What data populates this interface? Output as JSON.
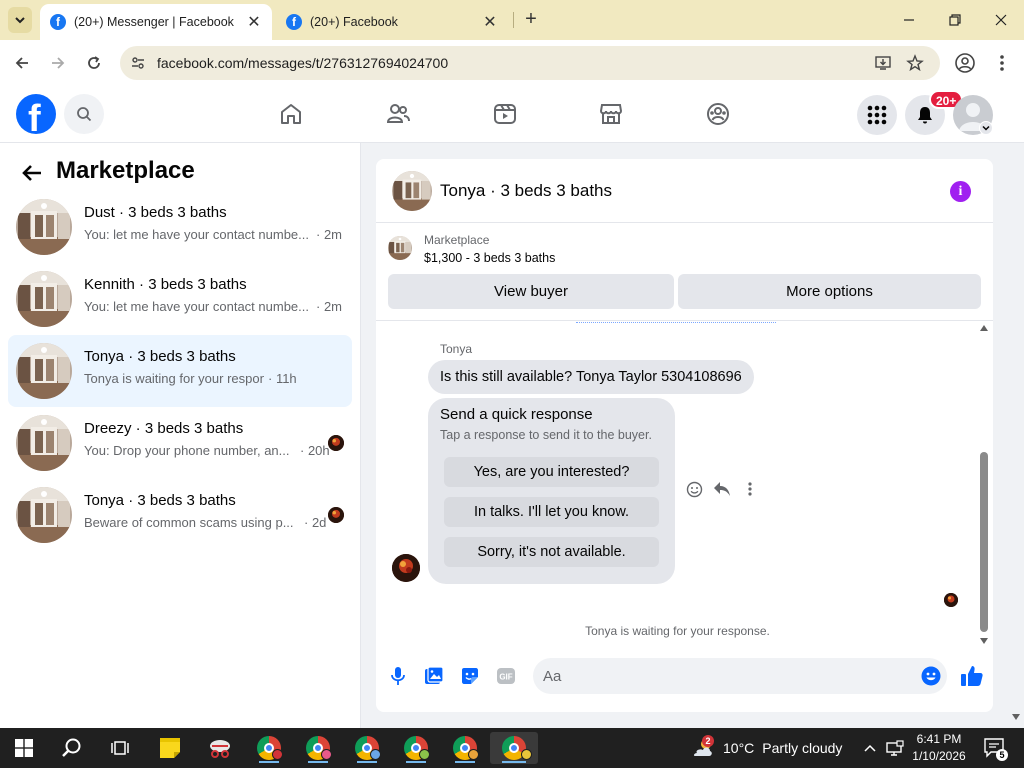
{
  "browser": {
    "tabs": [
      {
        "title": "(20+) Messenger | Facebook",
        "active": true
      },
      {
        "title": "(20+) Facebook",
        "active": false
      }
    ],
    "url": "facebook.com/messages/t/2763127694024700"
  },
  "fb": {
    "logo_letter": "f",
    "notifications_badge": "20+"
  },
  "sidebar": {
    "title": "Marketplace",
    "conversations": [
      {
        "name": "Dust · 3 beds 3 baths",
        "preview": "You: let me have your contact numbe...",
        "time": "· 2m",
        "selected": false,
        "seen": false
      },
      {
        "name": "Kennith · 3 beds 3 baths",
        "preview": "You: let me have your contact numbe...",
        "time": "· 2m",
        "selected": false,
        "seen": false
      },
      {
        "name": "Tonya · 3 beds 3 baths",
        "preview": "Tonya is waiting for your response.",
        "time": "· 11h",
        "selected": true,
        "seen": false
      },
      {
        "name": "Dreezy · 3 beds 3 baths",
        "preview": "You: Drop your phone number, an...",
        "time": "· 20h",
        "selected": false,
        "seen": true
      },
      {
        "name": "Tonya · 3 beds 3 baths",
        "preview": "Beware of common scams using p...",
        "time": "· 2d",
        "selected": false,
        "seen": true
      }
    ]
  },
  "chat": {
    "title": "Tonya · 3 beds 3 baths",
    "info_letter": "i",
    "listing": {
      "label": "Marketplace",
      "price_title": "$1,300 - 3 beds 3 baths",
      "view_buyer": "View buyer",
      "more_options": "More options"
    },
    "messages": {
      "sender": "Tonya",
      "text": "Is this still available? Tonya Taylor 5304108696"
    },
    "quick_response": {
      "title": "Send a quick response",
      "subtitle": "Tap a response to send it to the buyer.",
      "options": [
        "Yes, are you interested?",
        "In talks. I'll let you know.",
        "Sorry, it's not available."
      ]
    },
    "status": "Tonya is waiting for your response.",
    "composer": {
      "placeholder": "Aa",
      "gif_label": "GIF"
    }
  },
  "taskbar": {
    "weather": {
      "temp": "10°C",
      "condition": "Partly cloudy",
      "badge": "2"
    },
    "clock": {
      "time": "6:41 PM",
      "date": "1/10/2026"
    },
    "notification_count": "5"
  },
  "colors": {
    "fb_blue": "#0866ff",
    "selected_row": "#ebf5ff",
    "badge_red": "#e41e3f",
    "info_purple": "#a020f0",
    "chrome_tabbar": "#f1e9c0"
  }
}
